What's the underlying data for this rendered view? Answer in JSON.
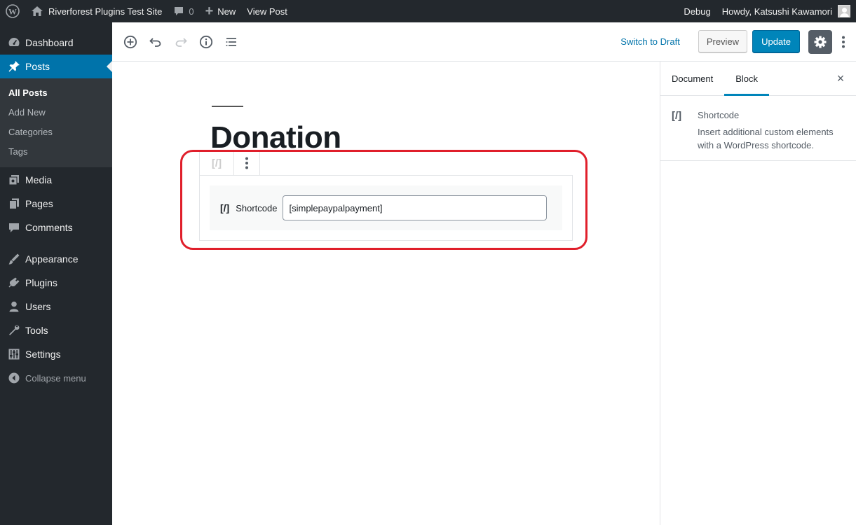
{
  "adminbar": {
    "site_name": "Riverforest Plugins Test Site",
    "comments_count": "0",
    "new_label": "New",
    "view_post_label": "View Post",
    "debug_label": "Debug",
    "howdy_label": "Howdy, Katsushi Kawamori"
  },
  "sidebar": {
    "items": [
      {
        "label": "Dashboard",
        "icon": "dashboard-icon"
      },
      {
        "label": "Posts",
        "icon": "pin-icon"
      },
      {
        "label": "Media",
        "icon": "media-icon"
      },
      {
        "label": "Pages",
        "icon": "pages-icon"
      },
      {
        "label": "Comments",
        "icon": "comments-icon"
      },
      {
        "label": "Appearance",
        "icon": "appearance-icon"
      },
      {
        "label": "Plugins",
        "icon": "plugins-icon"
      },
      {
        "label": "Users",
        "icon": "users-icon"
      },
      {
        "label": "Tools",
        "icon": "tools-icon"
      },
      {
        "label": "Settings",
        "icon": "settings-icon"
      }
    ],
    "posts_submenu": [
      "All Posts",
      "Add New",
      "Categories",
      "Tags"
    ],
    "collapse_label": "Collapse menu"
  },
  "toolbar": {
    "switch_to_draft": "Switch to Draft",
    "preview": "Preview",
    "update": "Update"
  },
  "post": {
    "title": "Donation"
  },
  "shortcode_block": {
    "glyph": "[/]",
    "label": "Shortcode",
    "value": "[simplepaypalpayment]"
  },
  "panel": {
    "tabs": [
      "Document",
      "Block"
    ],
    "active_tab": "Block",
    "close_glyph": "×",
    "block_glyph": "[/]",
    "block_name": "Shortcode",
    "block_description": "Insert additional custom elements with a WordPress shortcode."
  },
  "colors": {
    "admin_dark": "#23282d",
    "accent_blue": "#0073aa",
    "highlight_red": "#e01f2b"
  }
}
